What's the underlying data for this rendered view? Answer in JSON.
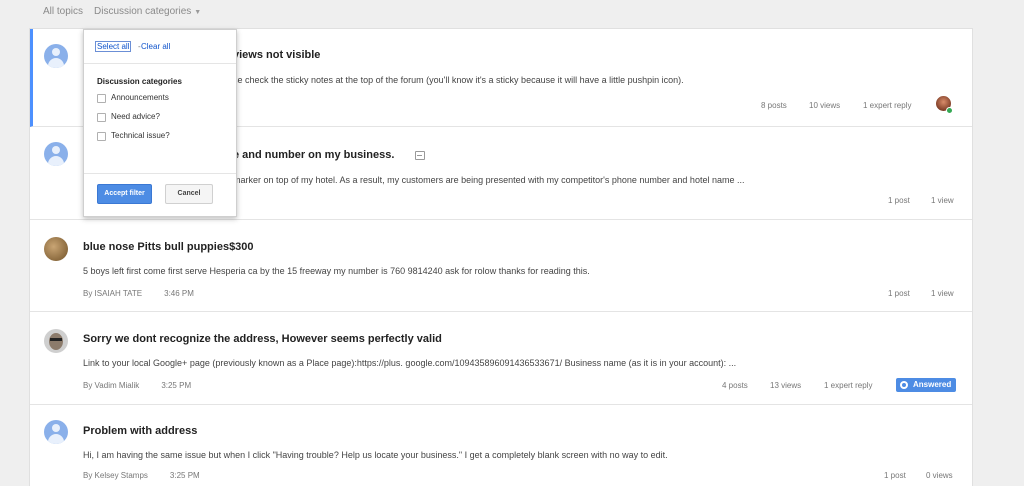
{
  "breadcrumb": {
    "all_topics": "All topics",
    "discussion_categories": "Discussion categories"
  },
  "dropdown": {
    "select_all": "Select all",
    "separator": "-",
    "clear_all": "Clear all",
    "heading": "Discussion categories",
    "options": [
      {
        "label": "Announcements",
        "checked": false
      },
      {
        "label": "Need advice?",
        "checked": false
      },
      {
        "label": "Technical issue?",
        "checked": false
      }
    ],
    "accept_label": "Accept filter",
    "cancel_label": "Cancel"
  },
  "topics": [
    {
      "title": "views not visible",
      "snippet": "se check the sticky notes at the top of the forum (you'll know it's a sticky because it will have a little pushpin icon).",
      "posts": "8 posts",
      "views": "10 views",
      "expert": "1 expert reply"
    },
    {
      "title": "e and number on my business.",
      "snippet": "marker on top of my hotel. As a result, my customers are being presented with my competitor's phone number and hotel name ...",
      "posts": "1 post",
      "views": "1 view"
    },
    {
      "title": "blue nose Pitts bull puppies$300",
      "snippet": "5 boys left first come first serve Hesperia ca by the 15 freeway my number is 760 9814240 ask for rolow thanks for reading this.",
      "author": "By ISAIAH TATE",
      "time": "3:46 PM",
      "posts": "1 post",
      "views": "1 view"
    },
    {
      "title": "Sorry we dont recognize the address, However seems perfectly valid",
      "snippet": "Link to your local Google+ page (previously known as a Place page):https://plus. google.com/109435896091436533671/ Business name (as it is in your account): ...",
      "author": "By Vadim Mialik",
      "time": "3:25 PM",
      "posts": "4 posts",
      "views": "13 views",
      "expert": "1 expert reply",
      "badge": "Answered"
    },
    {
      "title": "Problem with address",
      "snippet": "Hi, I am having the same issue but when I click \"Having trouble? Help us locate your business.\" I get a completely blank screen with no way to edit.",
      "author": "By Kelsey Stamps",
      "time": "3:25 PM",
      "posts": "1 post",
      "views": "0 views"
    }
  ],
  "colors": {
    "accent": "#4d8ce4",
    "link": "#1155cc",
    "background": "#efefef"
  }
}
